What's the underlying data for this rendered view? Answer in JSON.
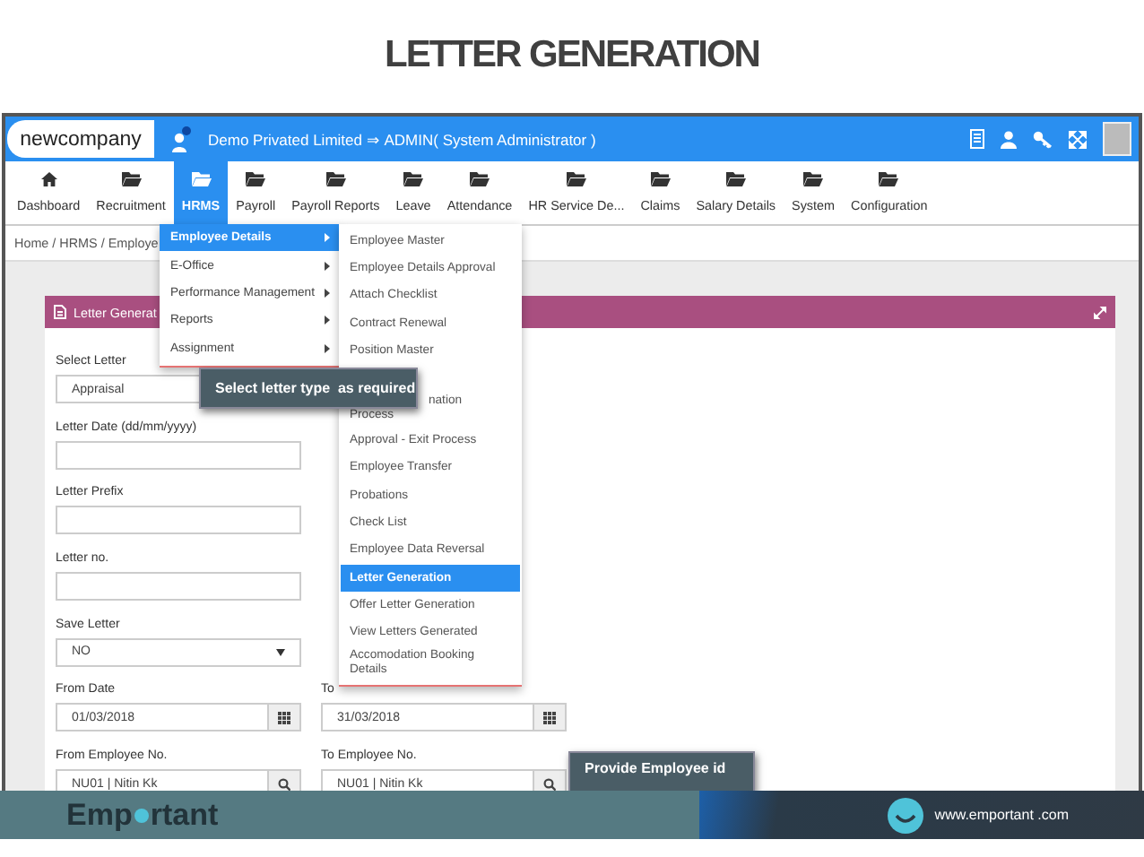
{
  "slide_title": "LETTER GENERATION",
  "app": {
    "logo": "newcompany",
    "header_text": "Demo Privated Limited ⇒ ADMIN( System Administrator )",
    "nav": [
      {
        "label": "Dashboard",
        "kind": "home",
        "selected": false
      },
      {
        "label": "Recruitment",
        "kind": "folder",
        "selected": false
      },
      {
        "label": "HRMS",
        "kind": "folder",
        "selected": true
      },
      {
        "label": "Payroll",
        "kind": "folder",
        "selected": false
      },
      {
        "label": "Payroll Reports",
        "kind": "folder",
        "selected": false
      },
      {
        "label": "Leave",
        "kind": "folder",
        "selected": false
      },
      {
        "label": "Attendance",
        "kind": "folder",
        "selected": false
      },
      {
        "label": "HR Service De...",
        "kind": "folder",
        "selected": false
      },
      {
        "label": "Claims",
        "kind": "folder",
        "selected": false
      },
      {
        "label": "Salary Details",
        "kind": "folder",
        "selected": false
      },
      {
        "label": "System",
        "kind": "folder",
        "selected": false
      },
      {
        "label": "Configuration",
        "kind": "folder",
        "selected": false
      }
    ],
    "breadcrumb": "Home / HRMS / Employe",
    "panel_title": "Letter Generat",
    "form_rows": [
      [
        {
          "label": "Select Letter",
          "kind": "select",
          "value": "Appraisal"
        }
      ],
      [
        {
          "label": "Letter Date (dd/mm/yyyy)",
          "kind": "text"
        }
      ],
      [
        {
          "label": "Letter Prefix",
          "kind": "text"
        }
      ],
      [
        {
          "label": "Letter no.",
          "kind": "text"
        }
      ],
      [
        {
          "label": "Save Letter",
          "kind": "dropdown",
          "value": "NO"
        }
      ],
      [
        {
          "label": "From Date",
          "kind": "date",
          "value": "01/03/2018"
        },
        {
          "label": "To",
          "kind": "date",
          "value": "31/03/2018"
        }
      ],
      [
        {
          "label": "From Employee No.",
          "kind": "lookup",
          "value": "NU01 | Nitin Kk"
        },
        {
          "label": "To Employee No.",
          "kind": "lookup",
          "value": "NU01 | Nitin Kk"
        }
      ]
    ],
    "menu": [
      {
        "label": "Employee Details",
        "selected": true
      },
      {
        "label": "E-Office",
        "selected": false
      },
      {
        "label": "Performance Management",
        "selected": false
      },
      {
        "label": "Reports",
        "selected": false
      },
      {
        "label": "Assignment",
        "selected": false
      }
    ],
    "submenu": [
      {
        "kind": "item",
        "label": "Employee Master",
        "selected": false
      },
      {
        "kind": "item",
        "label": "Employee Details Approval",
        "selected": false
      },
      {
        "kind": "item",
        "label": "Attach Checklist",
        "selected": false
      },
      {
        "kind": "item",
        "label": "Contract Renewal",
        "selected": false
      },
      {
        "kind": "item",
        "label": "Position Master",
        "selected": false
      },
      {
        "kind": "covered",
        "label": "nation",
        "label_2": "Process",
        "selected": false
      },
      {
        "kind": "item",
        "label": "Approval - Exit Process",
        "selected": false
      },
      {
        "kind": "item",
        "label": "Employee Transfer",
        "selected": false
      },
      {
        "kind": "item",
        "label": "Probations",
        "selected": false
      },
      {
        "kind": "item",
        "label": "Check List",
        "selected": false
      },
      {
        "kind": "item",
        "label": "Employee Data Reversal",
        "selected": false
      },
      {
        "kind": "item",
        "label": "Letter Generation",
        "selected": true
      },
      {
        "kind": "item",
        "label": "Offer Letter Generation",
        "selected": false
      },
      {
        "kind": "item",
        "label": "View Letters Generated",
        "selected": false
      },
      {
        "kind": "item",
        "label": "Accomodation Booking Details",
        "selected": false
      }
    ],
    "tooltips": [
      "Select letter type  as required",
      "Provide Employee id"
    ]
  },
  "footer": {
    "brand_start": "Emp",
    "brand_end": "rtant",
    "url": "www.emportant .com"
  }
}
